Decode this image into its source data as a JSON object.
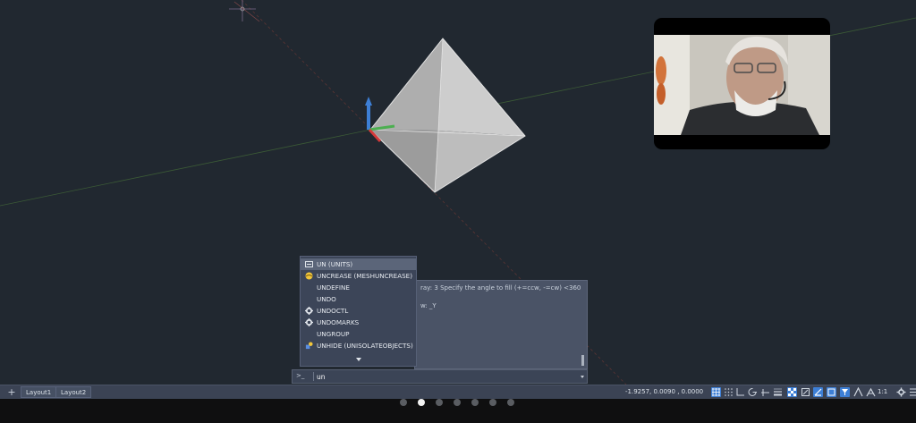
{
  "autocomplete": {
    "items": [
      {
        "label": "UN (UNITS)",
        "icon": "units-icon",
        "selected": true
      },
      {
        "label": "UNCREASE (MESHUNCREASE)",
        "icon": "mesh-uncrease-icon",
        "selected": false
      },
      {
        "label": "UNDEFINE",
        "icon": "",
        "selected": false
      },
      {
        "label": "UNDO",
        "icon": "",
        "selected": false
      },
      {
        "label": "UNDOCTL",
        "icon": "gear-icon",
        "selected": false
      },
      {
        "label": "UNDOMARKS",
        "icon": "gear-icon",
        "selected": false
      },
      {
        "label": "UNGROUP",
        "icon": "",
        "selected": false
      },
      {
        "label": "UNHIDE (UNISOLATEOBJECTS)",
        "icon": "unisolate-icon",
        "selected": false
      }
    ]
  },
  "command_history": {
    "lines": [
      "ray: 3 Specify the angle to fill (+=ccw, -=cw) <360>:",
      "",
      "w: _Y"
    ]
  },
  "command_line": {
    "prompt": ">_",
    "value": "un"
  },
  "status_bar": {
    "tabs": [
      "Layout1",
      "Layout2"
    ],
    "coordinates": "-1.9257, 0.0090 , 0.0000",
    "scale": "1:1"
  },
  "presenter": {
    "slide_count": 7,
    "active_slide": 2
  },
  "colors": {
    "viewport_bg": "#212830",
    "ucs_x": "#d43a3a",
    "ucs_y": "#4caf50",
    "ucs_z": "#3d7fd6",
    "accent": "#3d7fd6"
  }
}
